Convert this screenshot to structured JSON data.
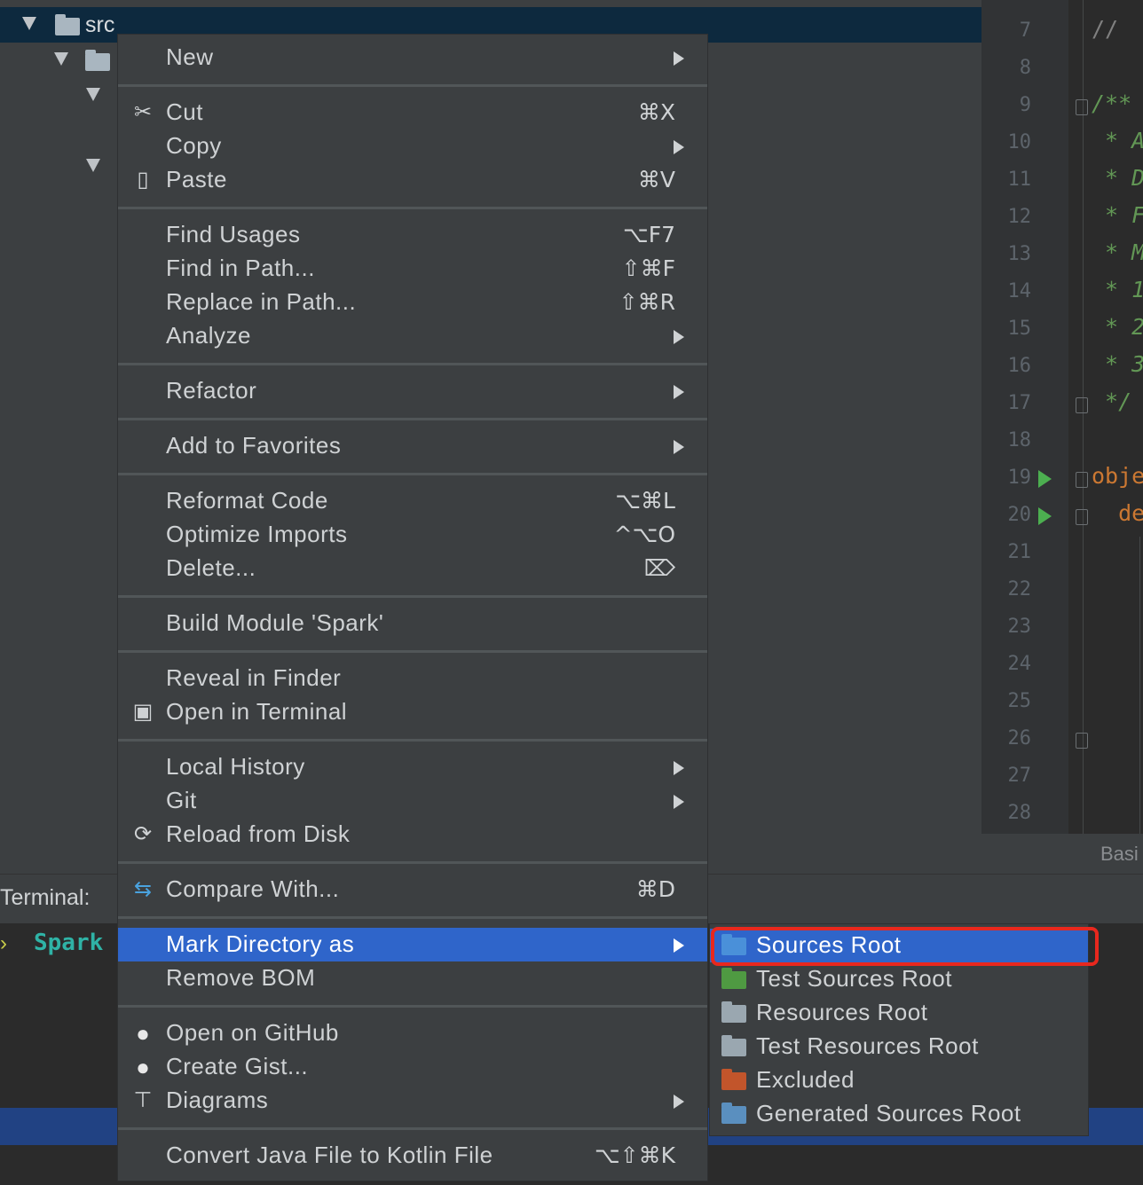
{
  "tree": {
    "root_label": "src"
  },
  "editor": {
    "line_numbers": [
      "7",
      "8",
      "9",
      "10",
      "11",
      "12",
      "13",
      "14",
      "15",
      "16",
      "17",
      "18",
      "19",
      "20",
      "21",
      "22",
      "23",
      "24",
      "25",
      "26",
      "27",
      "28"
    ],
    "code_lines": [
      {
        "line": "7",
        "text": "//",
        "cls": "cmt"
      },
      {
        "line": "9",
        "text": "/**",
        "cls": "doc"
      },
      {
        "line": "10",
        "text": " * A",
        "cls": "doc"
      },
      {
        "line": "11",
        "text": " * D",
        "cls": "doc"
      },
      {
        "line": "12",
        "text": " * F",
        "cls": "doc"
      },
      {
        "line": "13",
        "text": " * M",
        "cls": "doc"
      },
      {
        "line": "14",
        "text": " * 1",
        "cls": "doc"
      },
      {
        "line": "15",
        "text": " * 2",
        "cls": "doc"
      },
      {
        "line": "16",
        "text": " * 3",
        "cls": "doc"
      },
      {
        "line": "17",
        "text": " */",
        "cls": "doc"
      },
      {
        "line": "19",
        "text": "obje",
        "cls": "kw"
      },
      {
        "line": "20",
        "text": "  de",
        "cls": "kw"
      }
    ],
    "status_label": "Basi"
  },
  "terminal": {
    "header_label": "Terminal:",
    "prompt_symbol": "›",
    "tab_label": "Spark"
  },
  "context_menu": {
    "items": [
      {
        "label": "New",
        "shortcut": "",
        "submenu": true,
        "icon": ""
      },
      {
        "label": "Cut",
        "shortcut": "⌘X",
        "submenu": false,
        "icon": "scissors-icon"
      },
      {
        "label": "Copy",
        "shortcut": "",
        "submenu": true,
        "icon": ""
      },
      {
        "label": "Paste",
        "shortcut": "⌘V",
        "submenu": false,
        "icon": "clipboard-icon"
      },
      {
        "label": "Find Usages",
        "shortcut": "⌥F7",
        "submenu": false,
        "icon": ""
      },
      {
        "label": "Find in Path...",
        "shortcut": "⇧⌘F",
        "submenu": false,
        "icon": ""
      },
      {
        "label": "Replace in Path...",
        "shortcut": "⇧⌘R",
        "submenu": false,
        "icon": ""
      },
      {
        "label": "Analyze",
        "shortcut": "",
        "submenu": true,
        "icon": ""
      },
      {
        "label": "Refactor",
        "shortcut": "",
        "submenu": true,
        "icon": ""
      },
      {
        "label": "Add to Favorites",
        "shortcut": "",
        "submenu": true,
        "icon": ""
      },
      {
        "label": "Reformat Code",
        "shortcut": "⌥⌘L",
        "submenu": false,
        "icon": ""
      },
      {
        "label": "Optimize Imports",
        "shortcut": "^⌥O",
        "submenu": false,
        "icon": ""
      },
      {
        "label": "Delete...",
        "shortcut": "⌦",
        "submenu": false,
        "icon": ""
      },
      {
        "label": "Build Module 'Spark'",
        "shortcut": "",
        "submenu": false,
        "icon": ""
      },
      {
        "label": "Reveal in Finder",
        "shortcut": "",
        "submenu": false,
        "icon": ""
      },
      {
        "label": "Open in Terminal",
        "shortcut": "",
        "submenu": false,
        "icon": "terminal-icon"
      },
      {
        "label": "Local History",
        "shortcut": "",
        "submenu": true,
        "icon": ""
      },
      {
        "label": "Git",
        "shortcut": "",
        "submenu": true,
        "icon": ""
      },
      {
        "label": "Reload from Disk",
        "shortcut": "",
        "submenu": false,
        "icon": "reload-icon"
      },
      {
        "label": "Compare With...",
        "shortcut": "⌘D",
        "submenu": false,
        "icon": "compare-icon"
      },
      {
        "label": "Mark Directory as",
        "shortcut": "",
        "submenu": true,
        "icon": ""
      },
      {
        "label": "Remove BOM",
        "shortcut": "",
        "submenu": false,
        "icon": ""
      },
      {
        "label": "Open on GitHub",
        "shortcut": "",
        "submenu": false,
        "icon": "github-icon"
      },
      {
        "label": "Create Gist...",
        "shortcut": "",
        "submenu": false,
        "icon": "github-icon"
      },
      {
        "label": "Diagrams",
        "shortcut": "",
        "submenu": true,
        "icon": "diagram-icon"
      },
      {
        "label": "Convert Java File to Kotlin File",
        "shortcut": "⌥⇧⌘K",
        "submenu": false,
        "icon": ""
      }
    ]
  },
  "submenu": {
    "items": [
      {
        "label": "Sources Root",
        "icon": "sources-root-folder-icon",
        "color": "#4a90d9"
      },
      {
        "label": "Test Sources Root",
        "icon": "test-sources-root-folder-icon",
        "color": "#4f9a42"
      },
      {
        "label": "Resources Root",
        "icon": "resources-root-folder-icon",
        "color": "#9aa7b0"
      },
      {
        "label": "Test Resources Root",
        "icon": "test-resources-root-folder-icon",
        "color": "#9aa7b0"
      },
      {
        "label": "Excluded",
        "icon": "excluded-folder-icon",
        "color": "#c2552b"
      },
      {
        "label": "Generated Sources Root",
        "icon": "generated-sources-root-folder-icon",
        "color": "#5a8fbf"
      }
    ]
  },
  "colors": {
    "menu_bg": "#3c3f41",
    "selection": "#2f65ca",
    "highlight_box": "#e8281e"
  }
}
